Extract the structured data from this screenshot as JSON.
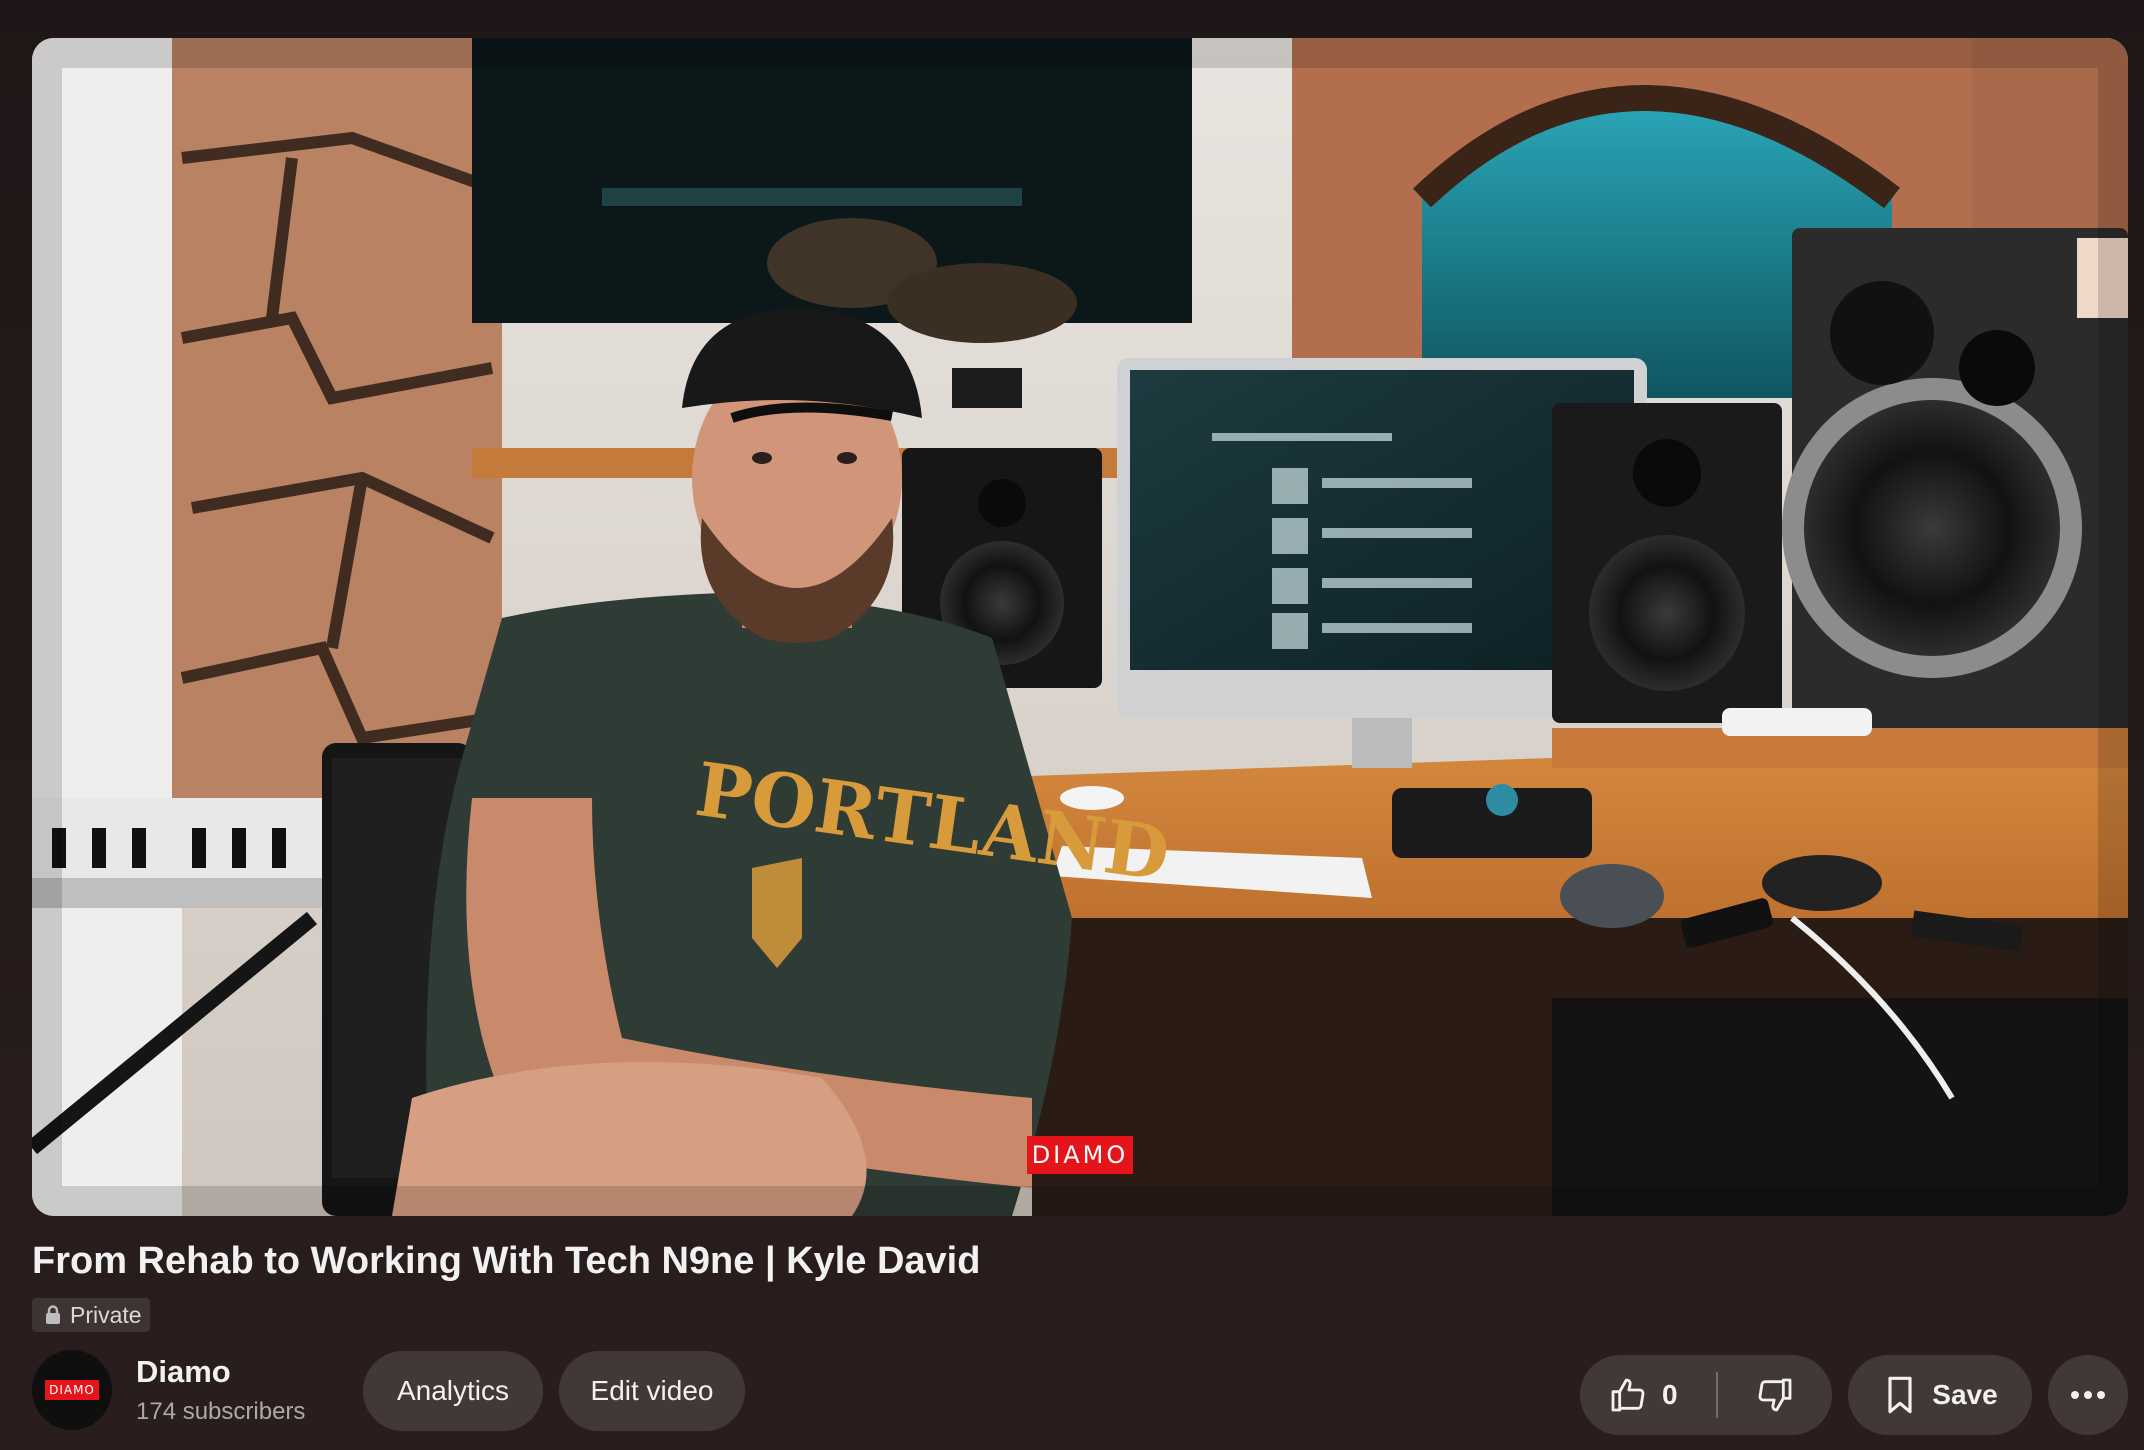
{
  "video": {
    "watermark": "DIAMO",
    "title": "From Rehab to Working With Tech N9ne | Kyle David",
    "privacy": "Private"
  },
  "channel": {
    "name": "Diamo",
    "subscribers": "174 subscribers",
    "avatar_text": "DIAMO"
  },
  "actions": {
    "analytics_label": "Analytics",
    "edit_video_label": "Edit video",
    "like_count": "0",
    "save_label": "Save"
  },
  "icons": {
    "privacy": "lock-icon",
    "like": "thumbs-up-icon",
    "dislike": "thumbs-down-icon",
    "save": "bookmark-icon",
    "more": "more-horizontal-icon"
  },
  "colors": {
    "background": "#241a1a",
    "button_bg": "rgba(255,255,255,0.12)",
    "brand_red": "#e4141a",
    "text_primary": "#f1f1f1",
    "text_secondary": "#aaaaaa"
  }
}
